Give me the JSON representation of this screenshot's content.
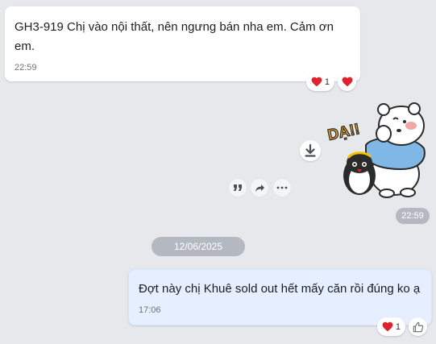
{
  "messages": [
    {
      "text": "GH3-919 Chị vào nội thất, nên ngưng bán nha em. Cảm ơn em.",
      "time": "22:59",
      "reaction_count": "1"
    },
    {
      "sticker_text": "DẠ!!",
      "time": "22:59"
    },
    {
      "text": "Đợt này chị Khuê sold out hết mấy căn rồi đúng ko ạ",
      "time": "17:06",
      "reaction_count": "1"
    }
  ],
  "date_separator": "12/06/2025",
  "colors": {
    "background": "#e6e8ec",
    "outgoing_bubble": "#e5efff",
    "incoming_bubble": "#ffffff",
    "heart": "#e0212e",
    "pill": "#b4b9c1"
  },
  "icons": {
    "reaction": "heart-icon",
    "like": "thumbs-up-icon",
    "download": "download-icon",
    "quote": "quote-icon",
    "forward": "forward-icon",
    "more": "more-icon"
  }
}
